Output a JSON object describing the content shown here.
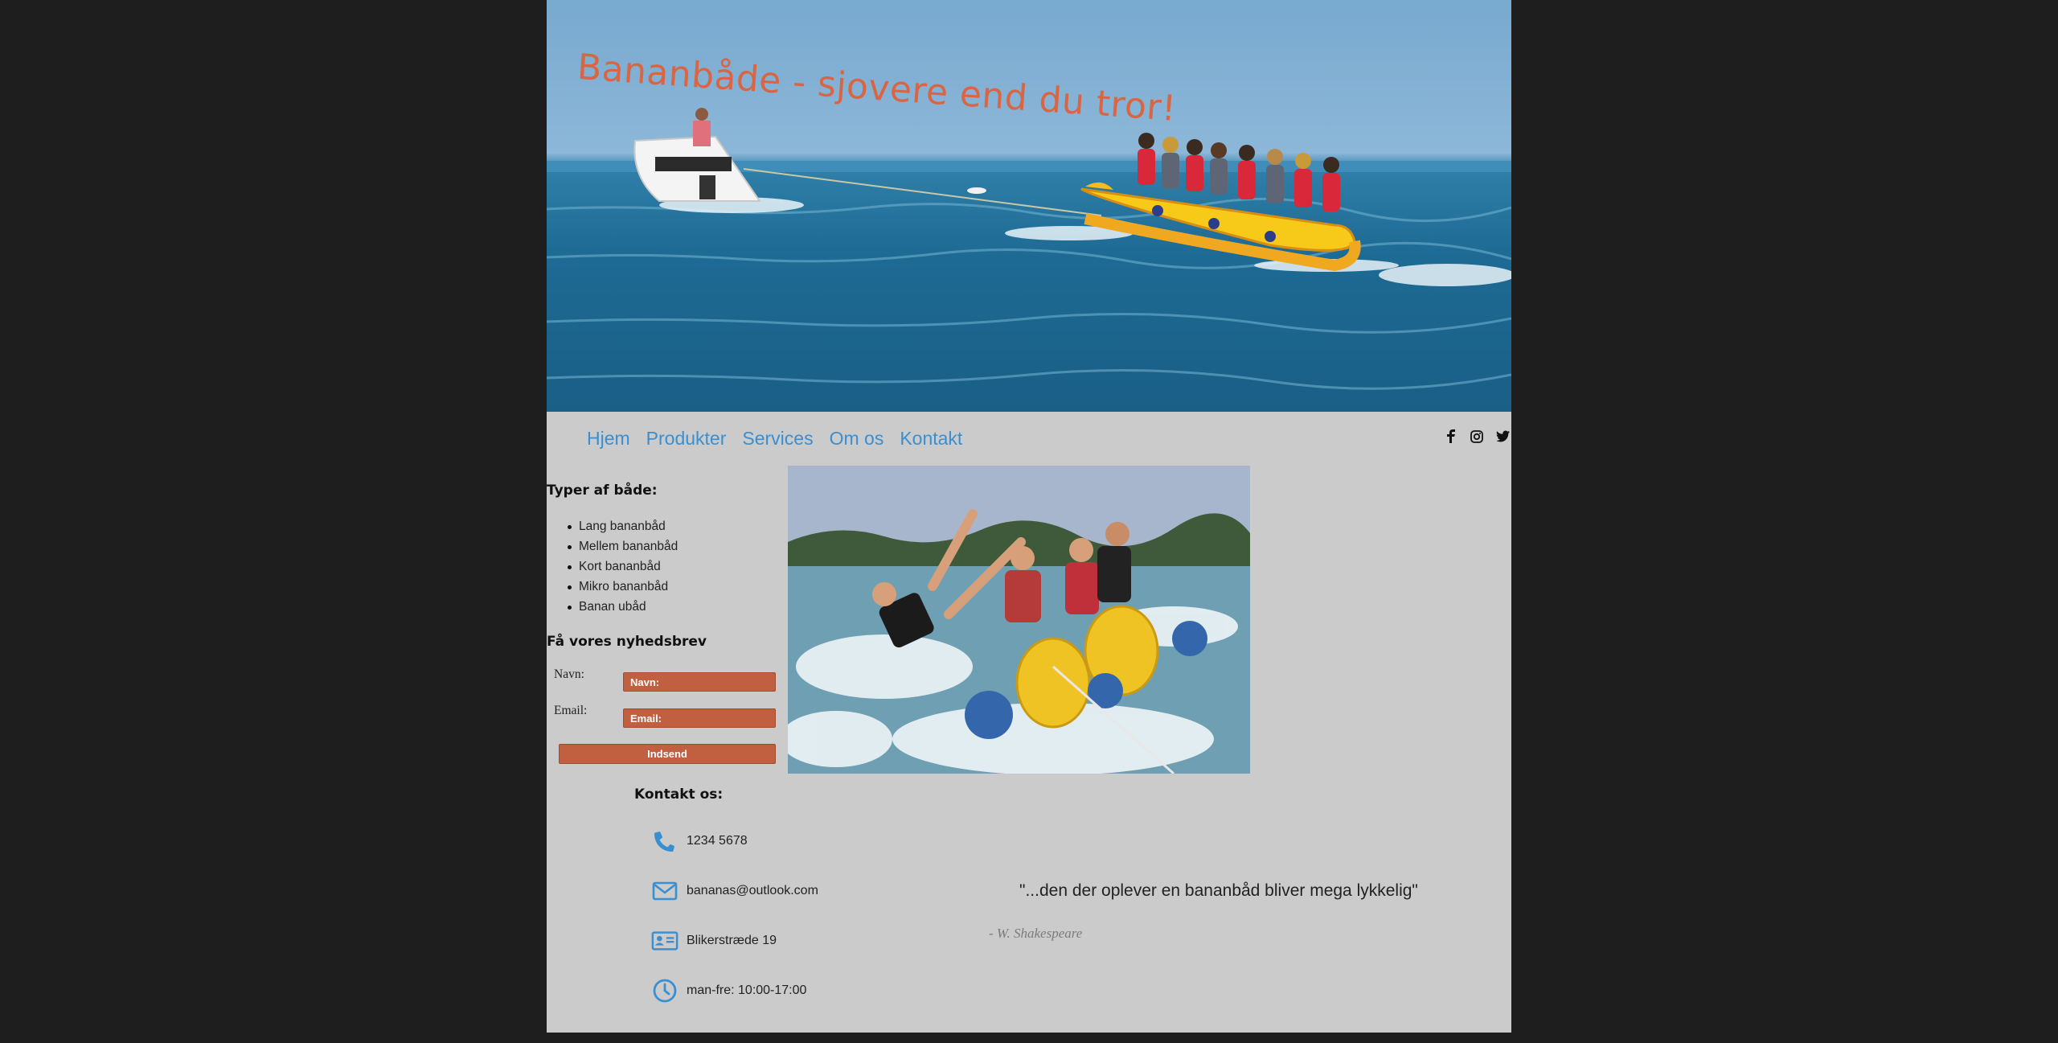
{
  "hero": {
    "title": "Bananbåde - sjovere end du tror!"
  },
  "nav": {
    "links": [
      {
        "label": "Hjem"
      },
      {
        "label": "Produkter"
      },
      {
        "label": "Services"
      },
      {
        "label": "Om os"
      },
      {
        "label": "Kontakt"
      }
    ],
    "social_icons": [
      "facebook-icon",
      "instagram-icon",
      "twitter-icon"
    ]
  },
  "sidebar": {
    "boat_types_heading": "Typer af både:",
    "boat_types": [
      "Lang bananbåd",
      "Mellem bananbåd",
      "Kort bananbåd",
      "Mikro bananbåd",
      "Banan ubåd"
    ],
    "newsletter_heading": "Få vores nyhedsbrev",
    "form": {
      "name_label": "Navn:",
      "name_placeholder": "Navn:",
      "email_label": "Email:",
      "email_placeholder": "Email:",
      "submit_label": "Indsend"
    }
  },
  "contact": {
    "heading": "Kontakt os:",
    "phone": "1234 5678",
    "email": "bananas@outlook.com",
    "address": "Blikerstræde 19",
    "hours": "man-fre: 10:00-17:00"
  },
  "quote": {
    "text": "\"...den der oplever en bananbåd bliver mega lykkelig\"",
    "author": "- W. Shakespeare"
  },
  "colors": {
    "accent": "#3a8fd0",
    "button": "#c15f41",
    "title": "#d96543",
    "page_bg": "#cbcbcb",
    "outer_bg": "#1e1e1e"
  }
}
